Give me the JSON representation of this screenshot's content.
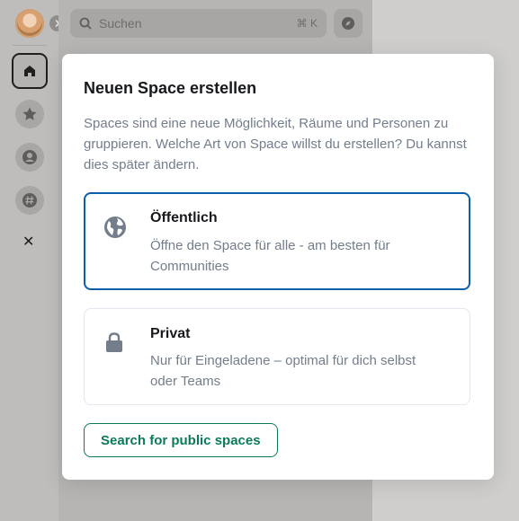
{
  "search": {
    "label": "Suchen",
    "shortcut": "⌘ K"
  },
  "sidebar": {
    "items": [
      {
        "icon": "home-icon"
      },
      {
        "icon": "star-icon"
      },
      {
        "icon": "person-icon"
      },
      {
        "icon": "hash-icon"
      }
    ],
    "close_glyph": "✕"
  },
  "dialog": {
    "title": "Neuen Space erstellen",
    "description": "Spaces sind eine neue Möglichkeit, Räume und Personen zu gruppieren. Welche Art von Space willst du erstellen? Du kannst dies später ändern.",
    "options": [
      {
        "title": "Öffentlich",
        "description": "Öffne den Space für alle - am besten für Communities",
        "icon": "globe-icon"
      },
      {
        "title": "Privat",
        "description": "Nur für Eingeladene – optimal für dich selbst oder Teams",
        "icon": "lock-icon"
      }
    ],
    "search_public_label": "Search for public spaces"
  },
  "colors": {
    "accent": "#0b5faa",
    "green": "#0b7a5a",
    "text": "#17191c",
    "muted": "#737d8c"
  }
}
